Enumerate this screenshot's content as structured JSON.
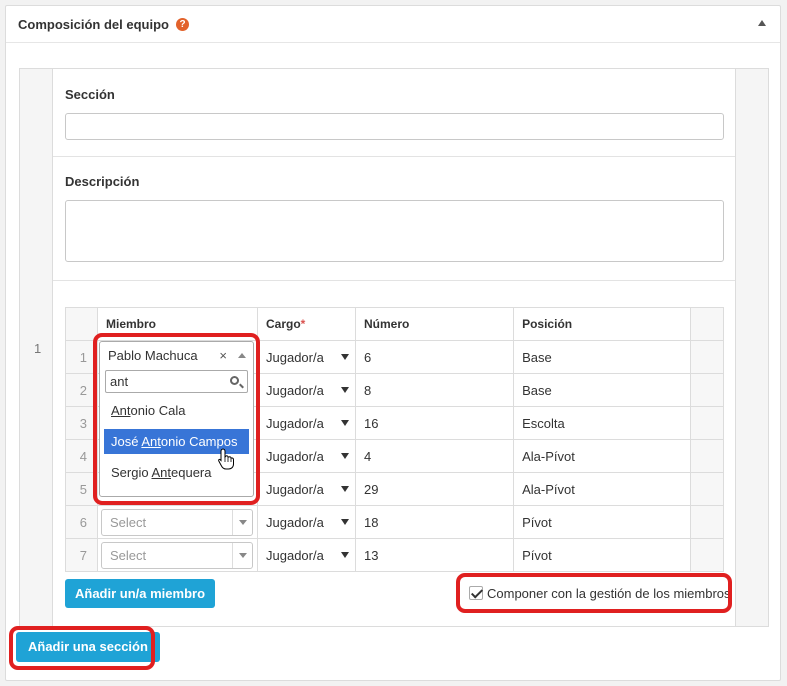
{
  "panel": {
    "title": "Composición del equipo",
    "help_glyph": "?"
  },
  "section": {
    "index": "1",
    "section_label": "Sección",
    "section_value": "",
    "description_label": "Descripción",
    "description_value": ""
  },
  "table": {
    "headers": {
      "member": "Miembro",
      "cargo": "Cargo",
      "cargo_required": "*",
      "number": "Número",
      "position": "Posición"
    },
    "rows": [
      {
        "n": "1",
        "member": "Pablo Machuca",
        "cargo": "Jugador/a",
        "number": "6",
        "position": "Base"
      },
      {
        "n": "2",
        "member": "",
        "cargo": "Jugador/a",
        "number": "8",
        "position": "Base"
      },
      {
        "n": "3",
        "member": "",
        "cargo": "Jugador/a",
        "number": "16",
        "position": "Escolta"
      },
      {
        "n": "4",
        "member": "",
        "cargo": "Jugador/a",
        "number": "4",
        "position": "Ala-Pívot"
      },
      {
        "n": "5",
        "member": "",
        "cargo": "Jugador/a",
        "number": "29",
        "position": "Ala-Pívot"
      },
      {
        "n": "6",
        "member": "Select",
        "cargo": "Jugador/a",
        "number": "18",
        "position": "Pívot"
      },
      {
        "n": "7",
        "member": "Select",
        "cargo": "Jugador/a",
        "number": "13",
        "position": "Pívot"
      }
    ]
  },
  "dropdown": {
    "selected": "Pablo Machuca",
    "clear_glyph": "×",
    "search_value": "ant",
    "options": [
      {
        "pre": "",
        "match": "Ant",
        "post": "onio Cala"
      },
      {
        "pre": "José ",
        "match": "Ant",
        "post": "onio Campos"
      },
      {
        "pre": "Sergio ",
        "match": "Ant",
        "post": "equera"
      }
    ],
    "active_index": 1
  },
  "buttons": {
    "add_member": "Añadir un/a miembro",
    "add_section": "Añadir una sección"
  },
  "checkbox": {
    "label": "Componer con la gestión de los miembros",
    "checked": true
  },
  "colors": {
    "accent": "#1fa3d6",
    "highlight": "#e02020",
    "option_active": "#3875d7"
  }
}
